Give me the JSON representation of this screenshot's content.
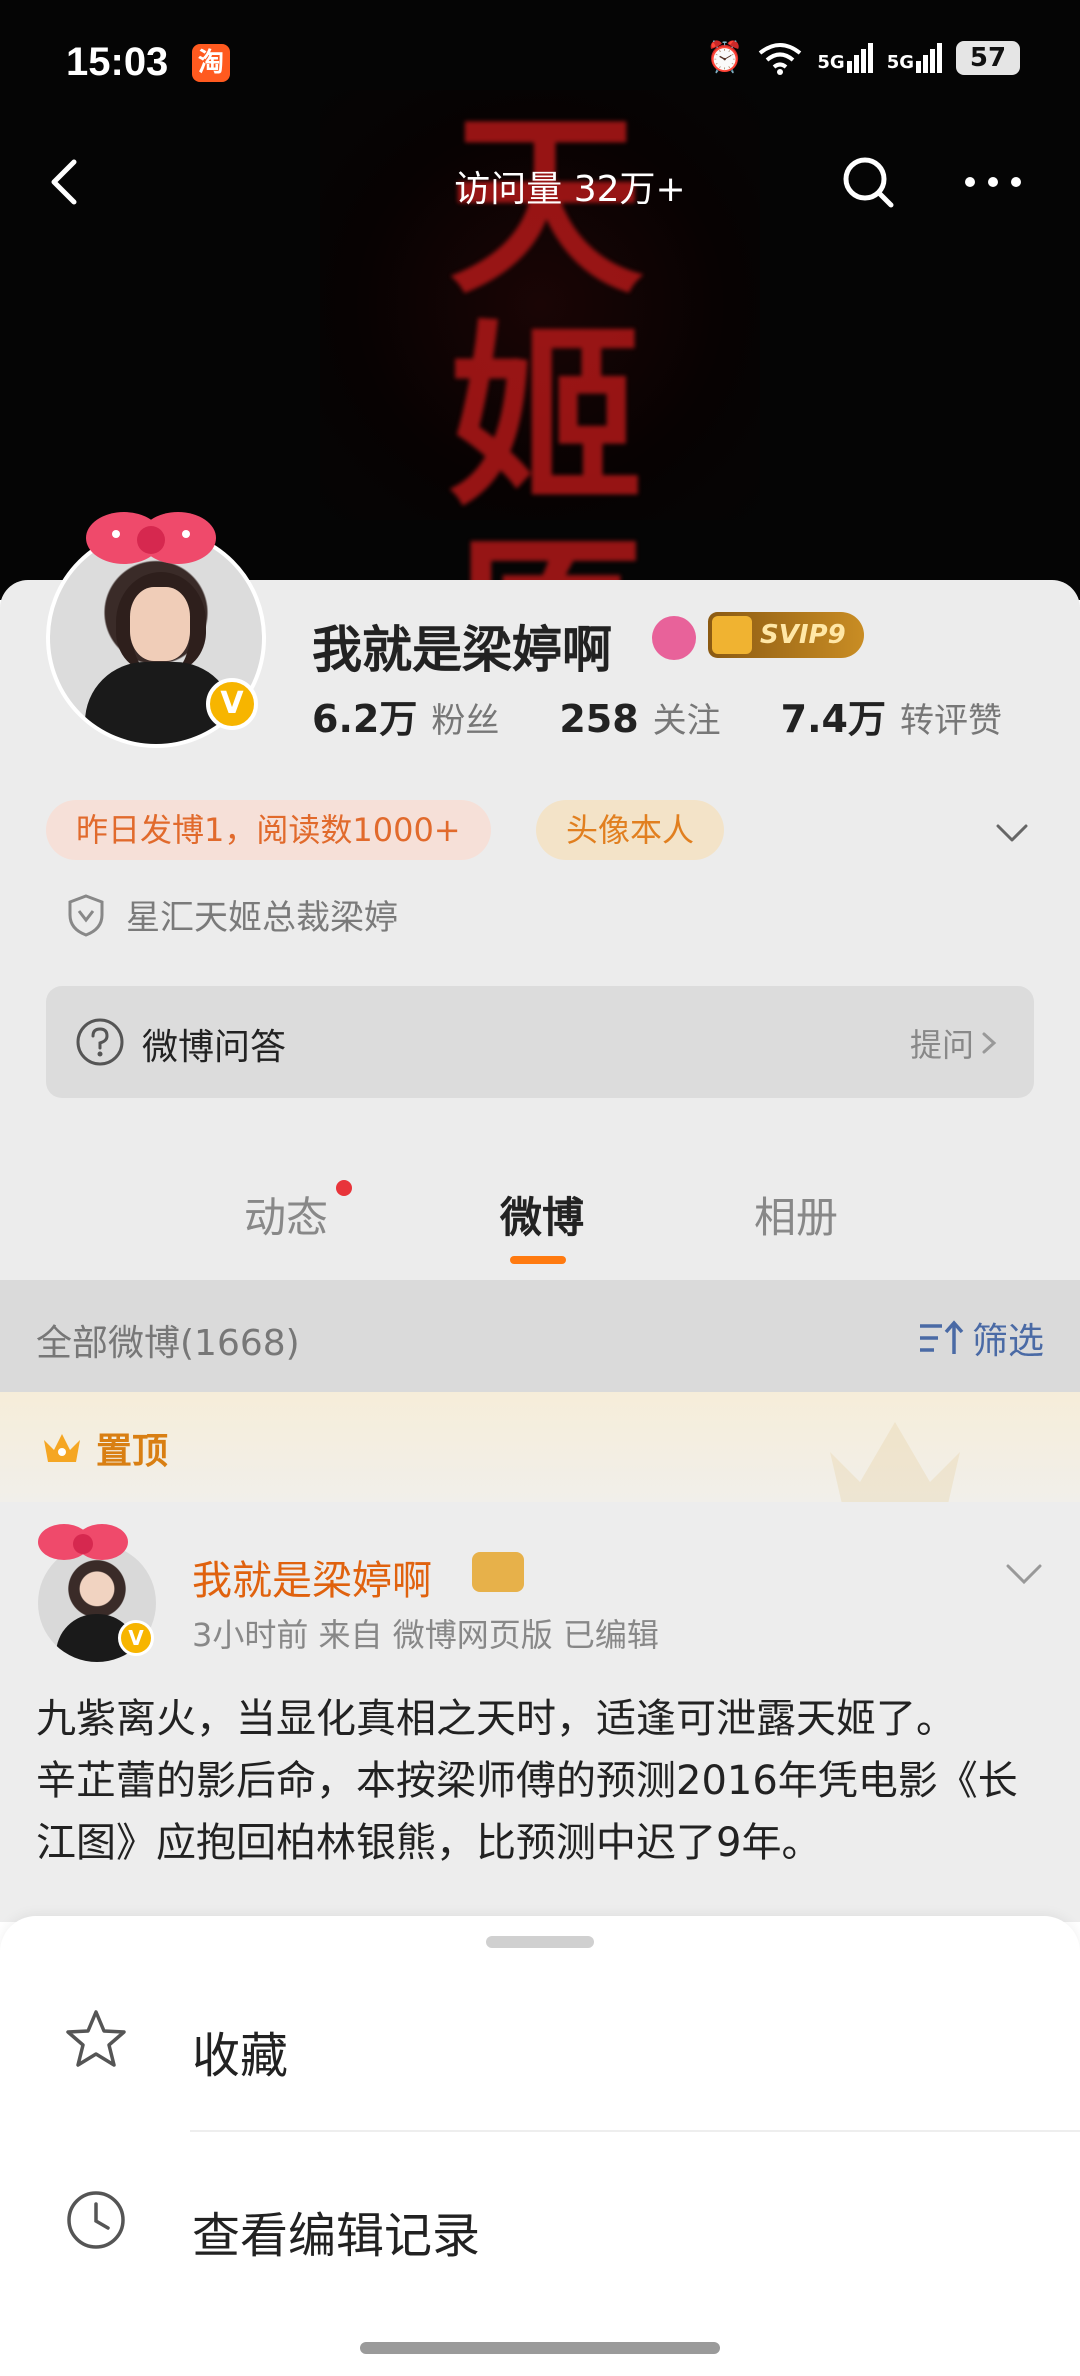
{
  "status": {
    "time": "15:03",
    "app_icon": "淘",
    "alarm_icon": "⏰",
    "wifi_icon": "wifi",
    "signal1": "5G",
    "signal2": "5G",
    "battery": "57"
  },
  "topnav": {
    "visits": "访问量 32万+"
  },
  "banner": {
    "art_text": "天姬原创"
  },
  "profile": {
    "username": "我就是梁婷啊",
    "svip": "SVIP9",
    "verified": "V",
    "stats": [
      {
        "value": "6.2万",
        "label": "粉丝"
      },
      {
        "value": "258",
        "label": "关注"
      },
      {
        "value": "7.4万",
        "label": "转评赞"
      }
    ],
    "tags": [
      "昨日发博1，阅读数1000+",
      "头像本人"
    ],
    "description": "星汇天姬总裁梁婷",
    "qa": {
      "label": "微博问答",
      "action": "提问"
    }
  },
  "tabs": {
    "items": [
      "动态",
      "微博",
      "相册"
    ],
    "active": "微博"
  },
  "filter": {
    "summary": "全部微博(1668)",
    "action": "筛选"
  },
  "pinned": {
    "label": "置顶"
  },
  "post": {
    "author": "我就是梁婷啊",
    "meta": "3小时前   来自 微博网页版   已编辑",
    "text_lines": [
      "九紫离火，当显化真相之天时，适逢可泄露天姬了。",
      "辛芷蕾的影后命，本按梁师傅的预测2016年凭电影《长江图》应抱回柏林银熊，比预测中迟了9年。"
    ]
  },
  "sheet": {
    "items": [
      {
        "label": "收藏",
        "icon": "star-icon"
      },
      {
        "label": "查看编辑记录",
        "icon": "clock-icon"
      }
    ]
  },
  "colors": {
    "accent": "#ff7a10",
    "link": "#4a6aa5",
    "author": "#e0620e",
    "banner_text": "#b01818"
  }
}
